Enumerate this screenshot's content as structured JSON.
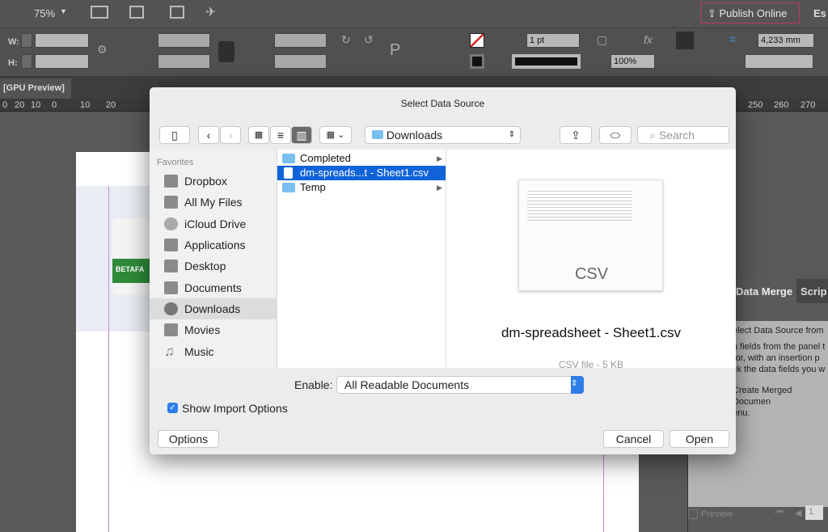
{
  "app": {
    "zoom": "75%",
    "publish_online": "Publish Online",
    "workspace": "Es",
    "doc_tab": "[GPU Preview]",
    "ctrl": {
      "w_label": "W:",
      "h_label": "H:",
      "stroke_weight": "1 pt",
      "opacity": "100%",
      "dimension": "4,233 mm"
    },
    "ruler_left": [
      "0",
      "20",
      "10",
      "0",
      "10",
      "20"
    ],
    "ruler_right": [
      "250",
      "260",
      "270"
    ],
    "product_text": "BETAFA"
  },
  "panel": {
    "tabs": [
      "Data Merge",
      "Scrip"
    ],
    "lines": [
      "elect Data Source from",
      "a fields from the panel t",
      " (or, with an insertion p",
      "ck the data fields you w",
      "",
      "Create Merged Documen",
      "enu."
    ],
    "preview": "Preview",
    "page": "1"
  },
  "dialog": {
    "title": "Select Data Source",
    "location": "Downloads",
    "search_placeholder": "Search",
    "favorites_heading": "Favorites",
    "sidebar": [
      {
        "label": "Dropbox",
        "icon": "dropbox-icon"
      },
      {
        "label": "All My Files",
        "icon": "all-files-icon"
      },
      {
        "label": "iCloud Drive",
        "icon": "cloud-icon"
      },
      {
        "label": "Applications",
        "icon": "applications-icon"
      },
      {
        "label": "Desktop",
        "icon": "desktop-icon"
      },
      {
        "label": "Documents",
        "icon": "documents-icon"
      },
      {
        "label": "Downloads",
        "icon": "downloads-icon",
        "selected": true
      },
      {
        "label": "Movies",
        "icon": "movies-icon"
      },
      {
        "label": "Music",
        "icon": "music-icon"
      }
    ],
    "files": [
      {
        "name": "Completed",
        "type": "folder"
      },
      {
        "name": "dm-spreads...t - Sheet1.csv",
        "type": "file",
        "selected": true
      },
      {
        "name": "Temp",
        "type": "folder"
      }
    ],
    "preview": {
      "icon_label": "CSV",
      "filename": "dm-spreadsheet - Sheet1.csv",
      "info": "CSV file - 5 KB"
    },
    "enable_label": "Enable:",
    "enable_value": "All Readable Documents",
    "show_import_options": "Show Import Options",
    "show_import_checked": true,
    "options": "Options",
    "cancel": "Cancel",
    "open": "Open"
  },
  "colors": {
    "accent": "#1a6fe0",
    "selection": "#1163d9"
  }
}
